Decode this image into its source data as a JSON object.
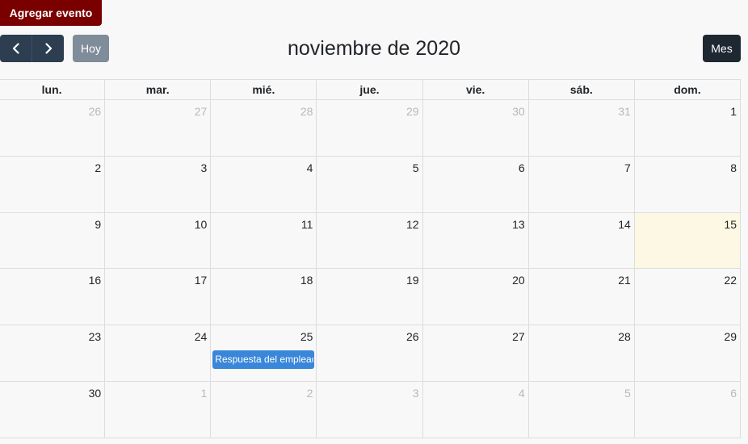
{
  "toolbar": {
    "add_label": "Agregar evento",
    "today_label": "Hoy",
    "title": "noviembre de 2020",
    "month_label": "Mes"
  },
  "calendar": {
    "weekdays": [
      "lun.",
      "mar.",
      "mié.",
      "jue.",
      "vie.",
      "sáb.",
      "dom."
    ],
    "weeks": [
      [
        {
          "d": "26",
          "o": true
        },
        {
          "d": "27",
          "o": true
        },
        {
          "d": "28",
          "o": true
        },
        {
          "d": "29",
          "o": true
        },
        {
          "d": "30",
          "o": true
        },
        {
          "d": "31",
          "o": true
        },
        {
          "d": "1"
        }
      ],
      [
        {
          "d": "2"
        },
        {
          "d": "3"
        },
        {
          "d": "4"
        },
        {
          "d": "5"
        },
        {
          "d": "6"
        },
        {
          "d": "7"
        },
        {
          "d": "8"
        }
      ],
      [
        {
          "d": "9"
        },
        {
          "d": "10"
        },
        {
          "d": "11"
        },
        {
          "d": "12"
        },
        {
          "d": "13"
        },
        {
          "d": "14"
        },
        {
          "d": "15",
          "today": true
        }
      ],
      [
        {
          "d": "16"
        },
        {
          "d": "17"
        },
        {
          "d": "18"
        },
        {
          "d": "19"
        },
        {
          "d": "20"
        },
        {
          "d": "21"
        },
        {
          "d": "22"
        }
      ],
      [
        {
          "d": "23"
        },
        {
          "d": "24"
        },
        {
          "d": "25",
          "event": "Respuesta del empleado"
        },
        {
          "d": "26"
        },
        {
          "d": "27"
        },
        {
          "d": "28"
        },
        {
          "d": "29"
        }
      ],
      [
        {
          "d": "30"
        },
        {
          "d": "1",
          "o": true
        },
        {
          "d": "2",
          "o": true
        },
        {
          "d": "3",
          "o": true
        },
        {
          "d": "4",
          "o": true
        },
        {
          "d": "5",
          "o": true
        },
        {
          "d": "6",
          "o": true
        }
      ]
    ]
  },
  "colors": {
    "add_button": "#7a0000",
    "nav_buttons": "#2c3e50",
    "today_button": "#7f8c99",
    "month_button": "#1e2832",
    "today_cell": "#fcf8e3",
    "event": "#3a87d9"
  }
}
